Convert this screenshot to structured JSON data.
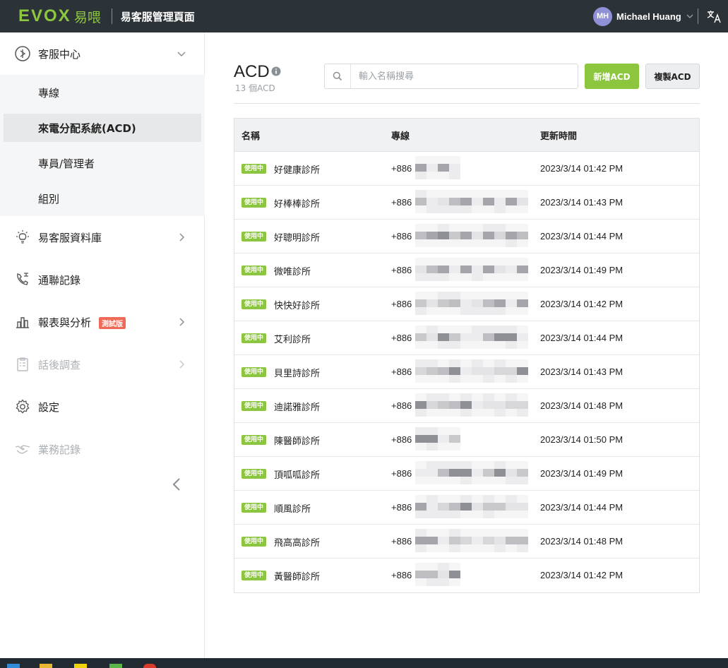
{
  "header": {
    "logo_text": "EVOX",
    "logo_cn": "易喂",
    "title": "易客服管理頁面",
    "user_initials": "MH",
    "user_name": "Michael Huang"
  },
  "sidebar": {
    "items": [
      {
        "label": "客服中心",
        "icon": "headset-icon"
      },
      {
        "label": "易客服資料庫",
        "icon": "lightbulb-icon"
      },
      {
        "label": "通聯記錄",
        "icon": "phone-log-icon"
      },
      {
        "label": "報表與分析",
        "icon": "bar-chart-icon",
        "badge": "測試版"
      },
      {
        "label": "話後調查",
        "icon": "clipboard-icon"
      },
      {
        "label": "設定",
        "icon": "gear-icon"
      },
      {
        "label": "業務記錄",
        "icon": "handshake-icon"
      }
    ],
    "submenu": [
      {
        "label": "專線"
      },
      {
        "label": "來電分配系統(ACD)"
      },
      {
        "label": "專員/管理者"
      },
      {
        "label": "組別"
      }
    ]
  },
  "main": {
    "title": "ACD",
    "count": "13 個ACD",
    "search_placeholder": "輸入名稱搜尋",
    "add_button": "新增ACD",
    "copy_button": "複製ACD",
    "columns": [
      "名稱",
      "專線",
      "更新時間"
    ],
    "status_label": "使用中",
    "rows": [
      {
        "name": "好健康診所",
        "phone": "+886",
        "time": "2023/3/14 01:42 PM"
      },
      {
        "name": "好棒棒診所",
        "phone": "+886",
        "time": "2023/3/14 01:43 PM"
      },
      {
        "name": "好聰明診所",
        "phone": "+886",
        "time": "2023/3/14 01:44 PM"
      },
      {
        "name": "微唯診所",
        "phone": "+886",
        "time": "2023/3/14 01:49 PM"
      },
      {
        "name": "快快好診所",
        "phone": "+886",
        "time": "2023/3/14 01:42 PM"
      },
      {
        "name": "艾利診所",
        "phone": "+886",
        "time": "2023/3/14 01:44 PM"
      },
      {
        "name": "貝里詩診所",
        "phone": "+886",
        "time": "2023/3/14 01:43 PM"
      },
      {
        "name": "迪諾雅診所",
        "phone": "+886",
        "time": "2023/3/14 01:48 PM"
      },
      {
        "name": "陳醫師診所",
        "phone": "+886",
        "time": "2023/3/14 01:50 PM"
      },
      {
        "name": "頂呱呱診所",
        "phone": "+886",
        "time": "2023/3/14 01:49 PM"
      },
      {
        "name": "順風診所",
        "phone": "+886",
        "time": "2023/3/14 01:44 PM"
      },
      {
        "name": "飛高高診所",
        "phone": "+886",
        "time": "2023/3/14 01:48 PM"
      },
      {
        "name": "黃醫師診所",
        "phone": "+886",
        "time": "2023/3/14 01:42 PM"
      }
    ]
  },
  "colors": {
    "header_bg": "#2c3338",
    "brand_green": "#8cc63f",
    "trial_badge": "#f06b57"
  }
}
